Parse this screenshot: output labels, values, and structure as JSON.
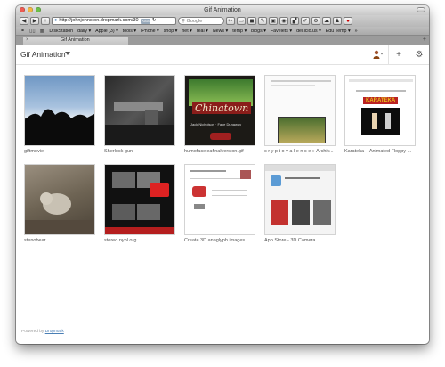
{
  "window": {
    "title": "Gif Animation"
  },
  "toolbar": {
    "url": "http://johnjohnston.dropmark.com/30",
    "rss_label": "RSS",
    "search_placeholder": "Google"
  },
  "bookmarks": [
    "DiskStation",
    "daily ▾",
    "Apple (3) ▾",
    "tools ▾",
    "iPhone ▾",
    "shop ▾",
    "net ▾",
    "real ▾",
    "News ▾",
    "temp ▾",
    "blogs ▾",
    "Favelets ▾",
    "del.icio.us ▾",
    "Edu Temp ▾"
  ],
  "tab": {
    "title": "Gif Animation"
  },
  "page": {
    "title": "Gif Animation"
  },
  "items": [
    {
      "caption": "giftmovie"
    },
    {
      "caption": "Sherlock gun"
    },
    {
      "caption": "humofaceleafinalversion.gif"
    },
    {
      "caption": "c r y p t o v a l e n c e » Archiv..."
    },
    {
      "caption": "Karateka – Animated Floppy ..."
    },
    {
      "caption": "stenobear"
    },
    {
      "caption": "stereo.nypl.org"
    },
    {
      "caption": "Create 3D anaglyph images ..."
    },
    {
      "caption": "App Store - 3D Camera"
    }
  ],
  "thumb_text": {
    "chinatown_title": "Chinatown",
    "chinatown_sub": "Jack Nicholson · Faye Dunaway",
    "karateka_title": "KARATEKA"
  },
  "footer": {
    "prefix": "Powered by",
    "link": "Dropmark"
  },
  "colors": {
    "close": "#ee5b52",
    "minimize": "#f2b642",
    "zoom": "#6cbf4a",
    "link": "#4a7fb5"
  }
}
